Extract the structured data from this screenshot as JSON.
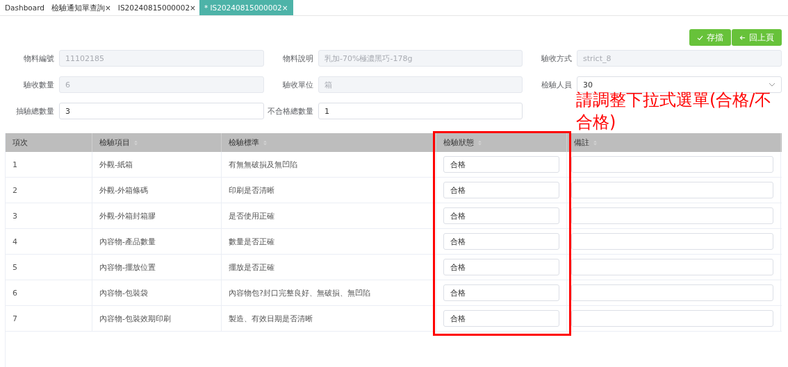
{
  "tabs": [
    {
      "label": "Dashboard",
      "selected": false
    },
    {
      "label": "檢驗通知單查詢",
      "close": "×",
      "selected": false
    },
    {
      "label": "IS20240815000002",
      "close": "×",
      "selected": false
    },
    {
      "label": "* IS20240815000002",
      "close": "×",
      "selected": true
    }
  ],
  "actions": [
    {
      "kind": "save",
      "label": "存擋"
    },
    {
      "kind": "back",
      "label": "回上頁"
    }
  ],
  "form": [
    {
      "label": "物料編號",
      "value": "11102185",
      "disabled": true,
      "kind": "input"
    },
    {
      "label": "物料說明",
      "value": "乳加-70%極濃黑巧-178g",
      "disabled": true,
      "kind": "input"
    },
    {
      "label": "驗收方式",
      "value": "strict_8",
      "disabled": true,
      "kind": "input"
    },
    {
      "label": "驗收數量",
      "value": "6",
      "disabled": true,
      "kind": "input"
    },
    {
      "label": "驗收單位",
      "value": "箱",
      "disabled": true,
      "kind": "input"
    },
    {
      "label": "檢驗人員",
      "value": "30",
      "disabled": false,
      "kind": "select"
    },
    {
      "label": "抽驗總數量",
      "value": "3",
      "disabled": false,
      "kind": "input"
    },
    {
      "label": "不合格總數量",
      "value": "1",
      "disabled": false,
      "kind": "input"
    }
  ],
  "annotation": {
    "text": "請調整下拉式選單(合格/不合格)"
  },
  "table": {
    "columns": [
      {
        "label": "項次",
        "sortable": false
      },
      {
        "label": "檢驗項目",
        "sortable": true
      },
      {
        "label": "檢驗標準",
        "sortable": true
      },
      {
        "label": "檢驗狀態",
        "sortable": true,
        "highlighted": true
      },
      {
        "label": "備註",
        "sortable": true
      }
    ],
    "rows": [
      {
        "no": "1",
        "item": "外觀-紙箱",
        "standard": "有無無破損及無凹陷",
        "status": "合格"
      },
      {
        "no": "2",
        "item": "外觀-外箱條碼",
        "standard": "印刷是否清晰",
        "status": "合格"
      },
      {
        "no": "3",
        "item": "外觀-外箱封箱膠",
        "standard": "是否使用正確",
        "status": "合格"
      },
      {
        "no": "4",
        "item": "內容物-產品數量",
        "standard": "數量是否正確",
        "status": "合格"
      },
      {
        "no": "5",
        "item": "內容物-擺放位置",
        "standard": "擺放是否正確",
        "status": "合格"
      },
      {
        "no": "6",
        "item": "內容物-包裝袋",
        "standard": "內容物包?封口完整良好、無破損、無凹陷",
        "status": "合格"
      },
      {
        "no": "7",
        "item": "內容物-包裝效期印刷",
        "standard": "製造、有效日期是否清晰",
        "status": "合格"
      }
    ]
  }
}
